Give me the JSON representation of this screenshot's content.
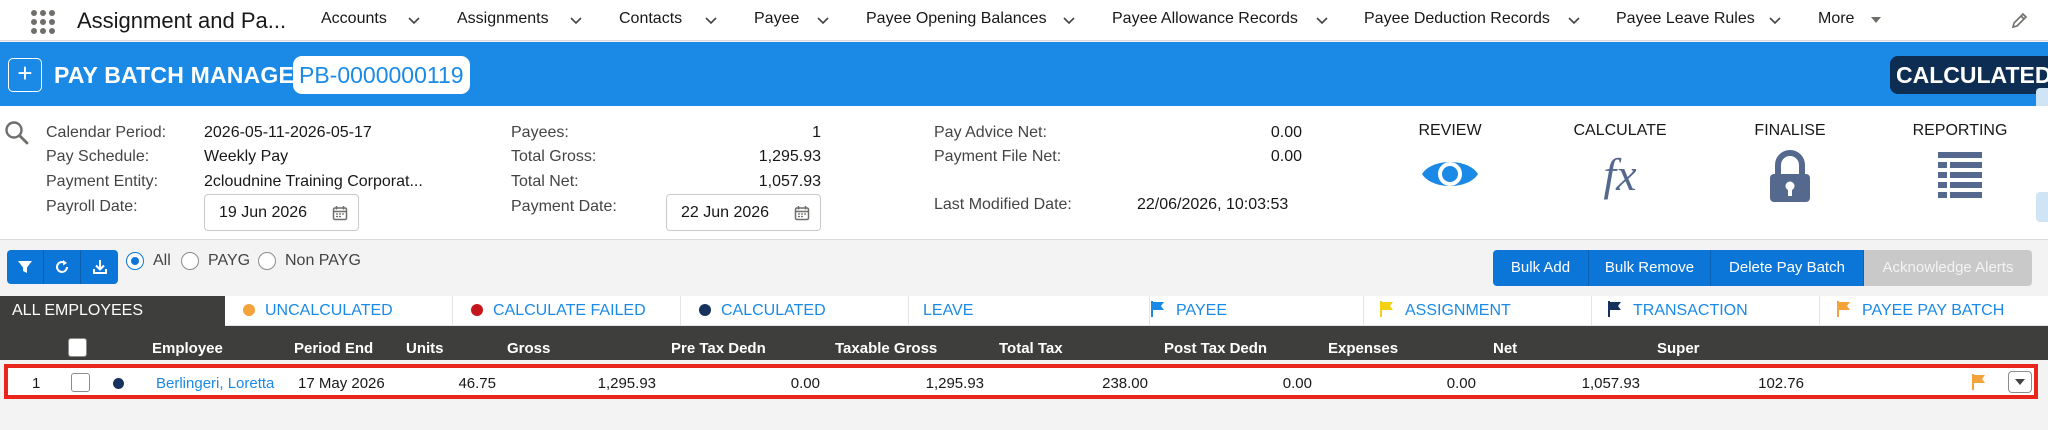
{
  "app": {
    "title": "Assignment and Pa..."
  },
  "nav": {
    "items": [
      "Accounts",
      "Assignments",
      "Contacts",
      "Payee",
      "Payee Opening Balances",
      "Payee Allowance Records",
      "Payee Deduction Records",
      "Payee Leave Rules"
    ],
    "more_label": "More"
  },
  "header": {
    "add_label": "+",
    "title": "PAY BATCH MANAGER",
    "batch_id": "PB-0000000119",
    "status": "CALCULATED"
  },
  "info": {
    "calendar_period_label": "Calendar Period:",
    "calendar_period": "2026-05-11-2026-05-17",
    "pay_schedule_label": "Pay Schedule:",
    "pay_schedule": "Weekly Pay",
    "payment_entity_label": "Payment Entity:",
    "payment_entity": "2cloudnine Training Corporat...",
    "payroll_date_label": "Payroll Date:",
    "payroll_date": "19 Jun 2026",
    "payees_label": "Payees:",
    "payees": "1",
    "total_gross_label": "Total Gross:",
    "total_gross": "1,295.93",
    "total_net_label": "Total Net:",
    "total_net": "1,057.93",
    "payment_date_label": "Payment Date:",
    "payment_date": "22 Jun 2026",
    "pay_advice_net_label": "Pay Advice Net:",
    "pay_advice_net": "0.00",
    "payment_file_net_label": "Payment File Net:",
    "payment_file_net": "0.00",
    "last_modified_label": "Last Modified Date:",
    "last_modified": "22/06/2026, 10:03:53"
  },
  "actions": {
    "review": "REVIEW",
    "calculate": "CALCULATE",
    "finalise": "FINALISE",
    "reporting": "REPORTING"
  },
  "filters": {
    "all": "All",
    "payg": "PAYG",
    "non_payg": "Non PAYG",
    "selected": "All"
  },
  "buttons": {
    "bulk_add": "Bulk Add",
    "bulk_remove": "Bulk Remove",
    "delete_batch": "Delete Pay Batch",
    "ack_alerts": "Acknowledge Alerts"
  },
  "tabs": {
    "all": "ALL EMPLOYEES",
    "uncalculated": "UNCALCULATED",
    "calc_failed": "CALCULATE FAILED",
    "calculated": "CALCULATED",
    "leave": "LEAVE",
    "payee": "PAYEE",
    "assignment": "ASSIGNMENT",
    "transaction": "TRANSACTION",
    "payee_pay_batch": "PAYEE PAY BATCH"
  },
  "colors": {
    "brand_blue": "#1b8ae6",
    "uncalculated": "#f4a23a",
    "calc_failed": "#c5161d",
    "calculated": "#16325c",
    "flag_blue": "#1b8ae6",
    "flag_yellow": "#f2d114",
    "flag_navy": "#16325c",
    "flag_orange": "#f4a23a",
    "highlight": "#e8261c"
  },
  "grid": {
    "columns": {
      "employee": "Employee",
      "period_end": "Period End",
      "units": "Units",
      "gross": "Gross",
      "pre_tax": "Pre Tax Dedn",
      "taxable_gross": "Taxable Gross",
      "total_tax": "Total Tax",
      "post_tax": "Post Tax Dedn",
      "expenses": "Expenses",
      "net": "Net",
      "super": "Super"
    },
    "rows": [
      {
        "num": "1",
        "employee": "Berlingeri, Loretta",
        "period_end": "17 May 2026",
        "units": "46.75",
        "gross": "1,295.93",
        "pre_tax": "0.00",
        "taxable_gross": "1,295.93",
        "total_tax": "238.00",
        "post_tax": "0.00",
        "expenses": "0.00",
        "net": "1,057.93",
        "super": "102.76"
      }
    ]
  }
}
